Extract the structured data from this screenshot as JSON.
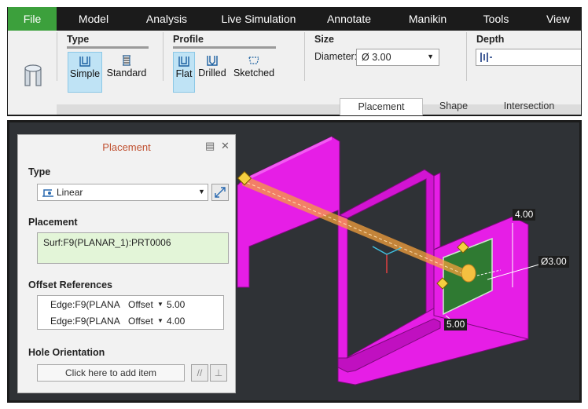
{
  "menu": {
    "tabs": [
      "File",
      "Model",
      "Analysis",
      "Live Simulation",
      "Annotate",
      "Manikin",
      "Tools",
      "View"
    ]
  },
  "ribbon": {
    "type_group": {
      "title": "Type",
      "simple": "Simple",
      "standard": "Standard"
    },
    "profile_group": {
      "title": "Profile",
      "flat": "Flat",
      "drilled": "Drilled",
      "sketched": "Sketched"
    },
    "size_group": {
      "title": "Size",
      "diameter_label": "Diameter:",
      "diameter_value": "Ø 3.00"
    },
    "depth_group": {
      "title": "Depth",
      "depth_value": ""
    },
    "sub_tabs": [
      "Placement",
      "Shape",
      "Intersection"
    ]
  },
  "panel": {
    "title": "Placement",
    "type_label": "Type",
    "type_value": "Linear",
    "placement_label": "Placement",
    "placement_value": "Surf:F9(PLANAR_1):PRT0006",
    "offset_label": "Offset References",
    "offsets": [
      {
        "edge": "Edge:F9(PLANA",
        "mode": "Offset",
        "value": "5.00"
      },
      {
        "edge": "Edge:F9(PLANA",
        "mode": "Offset",
        "value": "4.00"
      }
    ],
    "orientation_label": "Hole Orientation",
    "orientation_placeholder": "Click here to add item"
  },
  "viewport": {
    "dims": {
      "height": "4.00",
      "diameter": "Ø3.00",
      "width": "5.00"
    },
    "colors": {
      "model": "#e61ee6",
      "background": "#2f3236",
      "hole": "#f5a03c"
    }
  }
}
